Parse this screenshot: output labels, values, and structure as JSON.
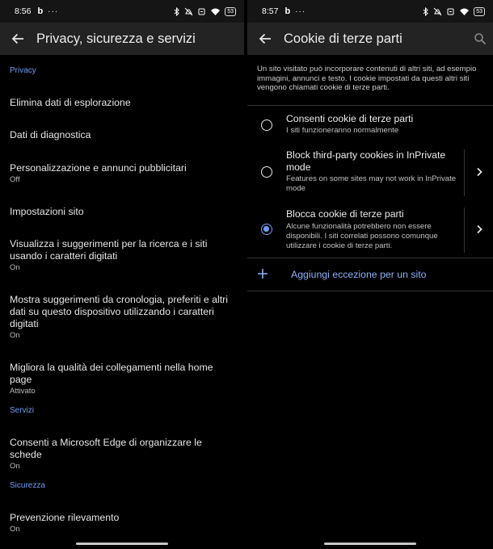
{
  "left": {
    "status": {
      "time": "8:56",
      "app_badge": "b",
      "dots": "···",
      "battery": "53"
    },
    "title": "Privacy, sicurezza e servizi",
    "sections": {
      "privacy": "Privacy",
      "servizi": "Servizi",
      "sicurezza": "Sicurezza"
    },
    "items": [
      {
        "title": "Elimina dati di esplorazione",
        "sub": ""
      },
      {
        "title": "Dati di diagnostica",
        "sub": ""
      },
      {
        "title": "Personalizzazione e annunci pubblicitari",
        "sub": "Off"
      },
      {
        "title": "Impostazioni sito",
        "sub": ""
      },
      {
        "title": "Visualizza i suggerimenti per la ricerca e i siti usando i caratteri digitati",
        "sub": "On"
      },
      {
        "title": "Mostra suggerimenti da cronologia, preferiti e altri dati su questo dispositivo utilizzando i caratteri digitati",
        "sub": "On"
      },
      {
        "title": "Migliora la qualità dei collegamenti nella home page",
        "sub": "Attivato"
      },
      {
        "title": "Consenti a Microsoft Edge di organizzare le schede",
        "sub": "On"
      },
      {
        "title": "Prevenzione rilevamento",
        "sub": "On"
      }
    ]
  },
  "right": {
    "status": {
      "time": "8:57",
      "app_badge": "b",
      "dots": "···",
      "battery": "53"
    },
    "title": "Cookie di terze parti",
    "description": "Un sito visitato può incorporare contenuti di altri siti, ad esempio immagini, annunci e testo. I cookie impostati da questi altri siti vengono chiamati cookie di terze parti.",
    "options": [
      {
        "title": "Consenti cookie di terze parti",
        "sub": "I siti funzioneranno normalmente",
        "selected": false
      },
      {
        "title": "Block third-party cookies in InPrivate mode",
        "sub": "Features on some sites may not work in InPrivate mode",
        "selected": false
      },
      {
        "title": "Blocca cookie di terze parti",
        "sub": "Alcune funzionalità potrebbero non essere disponibili. I siti correlati possono comunque utilizzare i cookie di terze parti.",
        "selected": true
      }
    ],
    "add_exception": "Aggiungi eccezione per un sito"
  },
  "colors": {
    "accent": "#6e9cf2",
    "background": "#000000",
    "appbar": "#232323",
    "statusbar": "#151515"
  },
  "icons": [
    "back-arrow-icon",
    "search-icon",
    "radio-button-icon",
    "chevron-right-icon",
    "plus-icon",
    "bluetooth-icon",
    "mute-icon",
    "wifi-icon",
    "battery-icon"
  ]
}
